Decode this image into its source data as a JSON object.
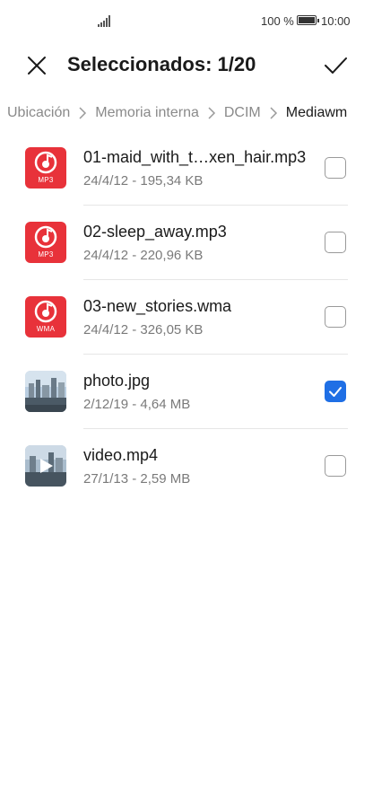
{
  "status_bar": {
    "battery_text": "100 %",
    "time": "10:00"
  },
  "header": {
    "title": "Seleccionados: 1/20",
    "close_icon": "close-icon",
    "confirm_icon": "checkmark-icon"
  },
  "breadcrumb": [
    {
      "label": "Ubicación"
    },
    {
      "label": "Memoria interna"
    },
    {
      "label": "DCIM"
    },
    {
      "label": "Mediawm"
    }
  ],
  "files": [
    {
      "name": "01-maid_with_t…xen_hair.mp3",
      "meta": "24/4/12 - 195,34 KB",
      "type": "audio",
      "ext": "MP3",
      "checked": false
    },
    {
      "name": "02-sleep_away.mp3",
      "meta": "24/4/12 - 220,96 KB",
      "type": "audio",
      "ext": "MP3",
      "checked": false
    },
    {
      "name": "03-new_stories.wma",
      "meta": "24/4/12 - 326,05 KB",
      "type": "audio",
      "ext": "WMA",
      "checked": false
    },
    {
      "name": "photo.jpg",
      "meta": "2/12/19 - 4,64 MB",
      "type": "image",
      "checked": true
    },
    {
      "name": "video.mp4",
      "meta": "27/1/13 - 2,59 MB",
      "type": "video",
      "checked": false
    }
  ],
  "colors": {
    "accent": "#1f6fe5",
    "audio_tile": "#e8323a"
  }
}
